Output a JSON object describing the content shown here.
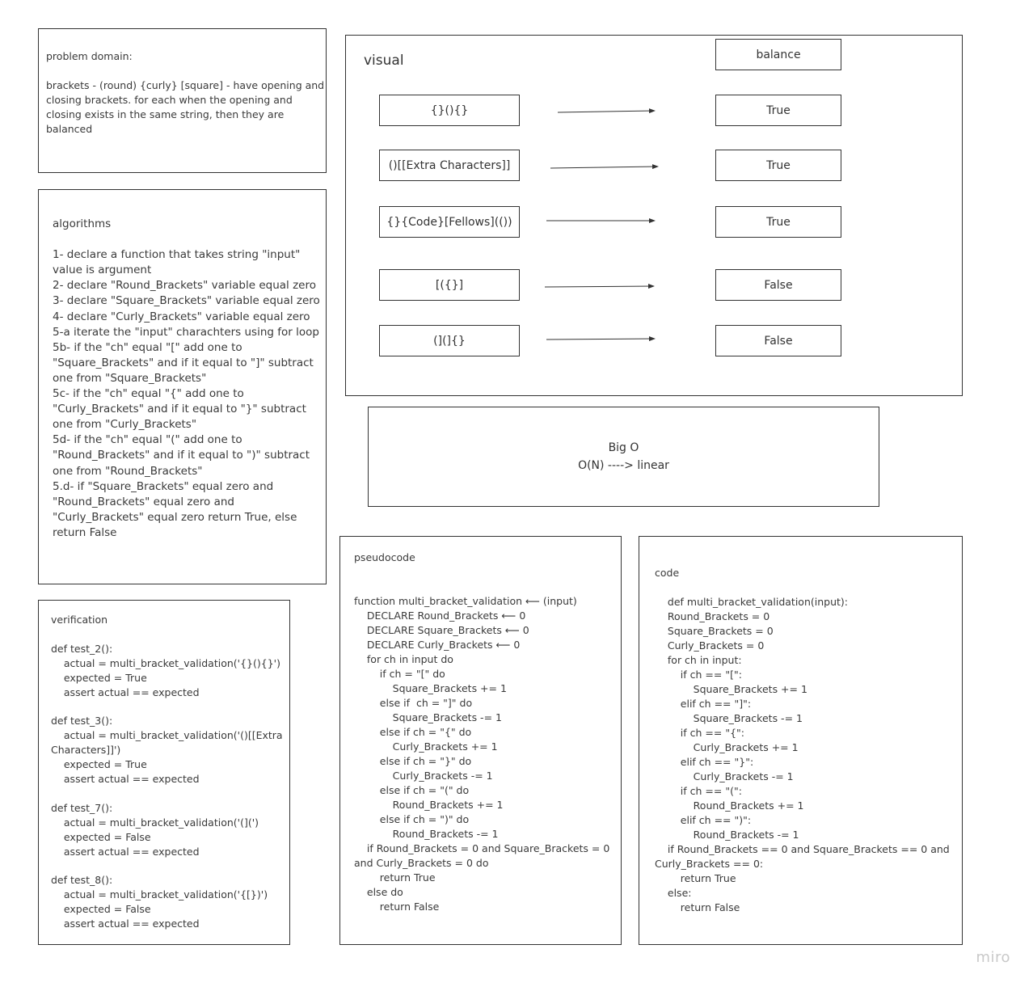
{
  "problem_domain": {
    "text": "problem domain:\n\nbrackets - (round) {curly} [square] - have opening and\nclosing brackets. for each when the opening and\nclosing exists in the same string, then they are\nbalanced"
  },
  "algorithms": {
    "text": "algorithms\n\n1- declare a function that takes string \"input\"\nvalue is argument\n2- declare \"Round_Brackets\" variable equal zero\n3- declare \"Square_Brackets\" variable equal zero\n4- declare \"Curly_Brackets\" variable equal zero\n5-a iterate the \"input\" charachters using for loop\n5b- if the \"ch\" equal \"[\" add one to\n\"Square_Brackets\" and if it equal to \"]\" subtract\none from \"Square_Brackets\"\n5c- if the \"ch\" equal \"{\" add one to\n\"Curly_Brackets\" and if it equal to \"}\" subtract\none from \"Curly_Brackets\"\n5d- if the \"ch\" equal \"(\" add one to\n\"Round_Brackets\" and if it equal to \")\" subtract\none from \"Round_Brackets\"\n5.d- if \"Square_Brackets\" equal zero and\n\"Round_Brackets\" equal zero and\n\"Curly_Brackets\" equal zero return True, else\nreturn False"
  },
  "verification": {
    "text": "verification\n\ndef test_2():\n    actual = multi_bracket_validation('{}(){}')\n    expected = True\n    assert actual == expected\n\ndef test_3():\n    actual = multi_bracket_validation('()[[Extra\nCharacters]]')\n    expected = True\n    assert actual == expected\n\ndef test_7():\n    actual = multi_bracket_validation('(](')\n    expected = False\n    assert actual == expected\n\ndef test_8():\n    actual = multi_bracket_validation('{[})')\n    expected = False\n    assert actual == expected"
  },
  "visual": {
    "title": "visual",
    "header": "balance",
    "rows": [
      {
        "input": "{}(){}",
        "result": "True"
      },
      {
        "input": "()[[Extra Characters]]",
        "result": "True"
      },
      {
        "input": "{}{Code}[Fellows](())",
        "result": "True"
      },
      {
        "input": "[({}]",
        "result": "False"
      },
      {
        "input": "(](]{}",
        "result": "False"
      }
    ]
  },
  "big_o": {
    "title": "Big O",
    "value": "O(N) ----> linear"
  },
  "pseudocode": {
    "text": "pseudocode\n\n\nfunction multi_bracket_validation ⟵ (input)\n    DECLARE Round_Brackets ⟵ 0\n    DECLARE Square_Brackets ⟵ 0\n    DECLARE Curly_Brackets ⟵ 0\n    for ch in input do\n        if ch = \"[\" do\n            Square_Brackets += 1\n        else if  ch = \"]\" do\n            Square_Brackets -= 1\n        else if ch = \"{\" do\n            Curly_Brackets += 1\n        else if ch = \"}\" do\n            Curly_Brackets -= 1\n        else if ch = \"(\" do\n            Round_Brackets += 1\n        else if ch = \")\" do\n            Round_Brackets -= 1\n    if Round_Brackets = 0 and Square_Brackets = 0\nand Curly_Brackets = 0 do\n        return True\n    else do\n        return False"
  },
  "code": {
    "text": "code\n\n    def multi_bracket_validation(input):\n    Round_Brackets = 0\n    Square_Brackets = 0\n    Curly_Brackets = 0\n    for ch in input:\n        if ch == \"[\":\n            Square_Brackets += 1\n        elif ch == \"]\":\n            Square_Brackets -= 1\n        if ch == \"{\":\n            Curly_Brackets += 1\n        elif ch == \"}\":\n            Curly_Brackets -= 1\n        if ch == \"(\":\n            Round_Brackets += 1\n        elif ch == \")\":\n            Round_Brackets -= 1\n    if Round_Brackets == 0 and Square_Brackets == 0 and\nCurly_Brackets == 0:\n        return True\n    else:\n        return False"
  },
  "brand": {
    "logo_text": "miro"
  }
}
